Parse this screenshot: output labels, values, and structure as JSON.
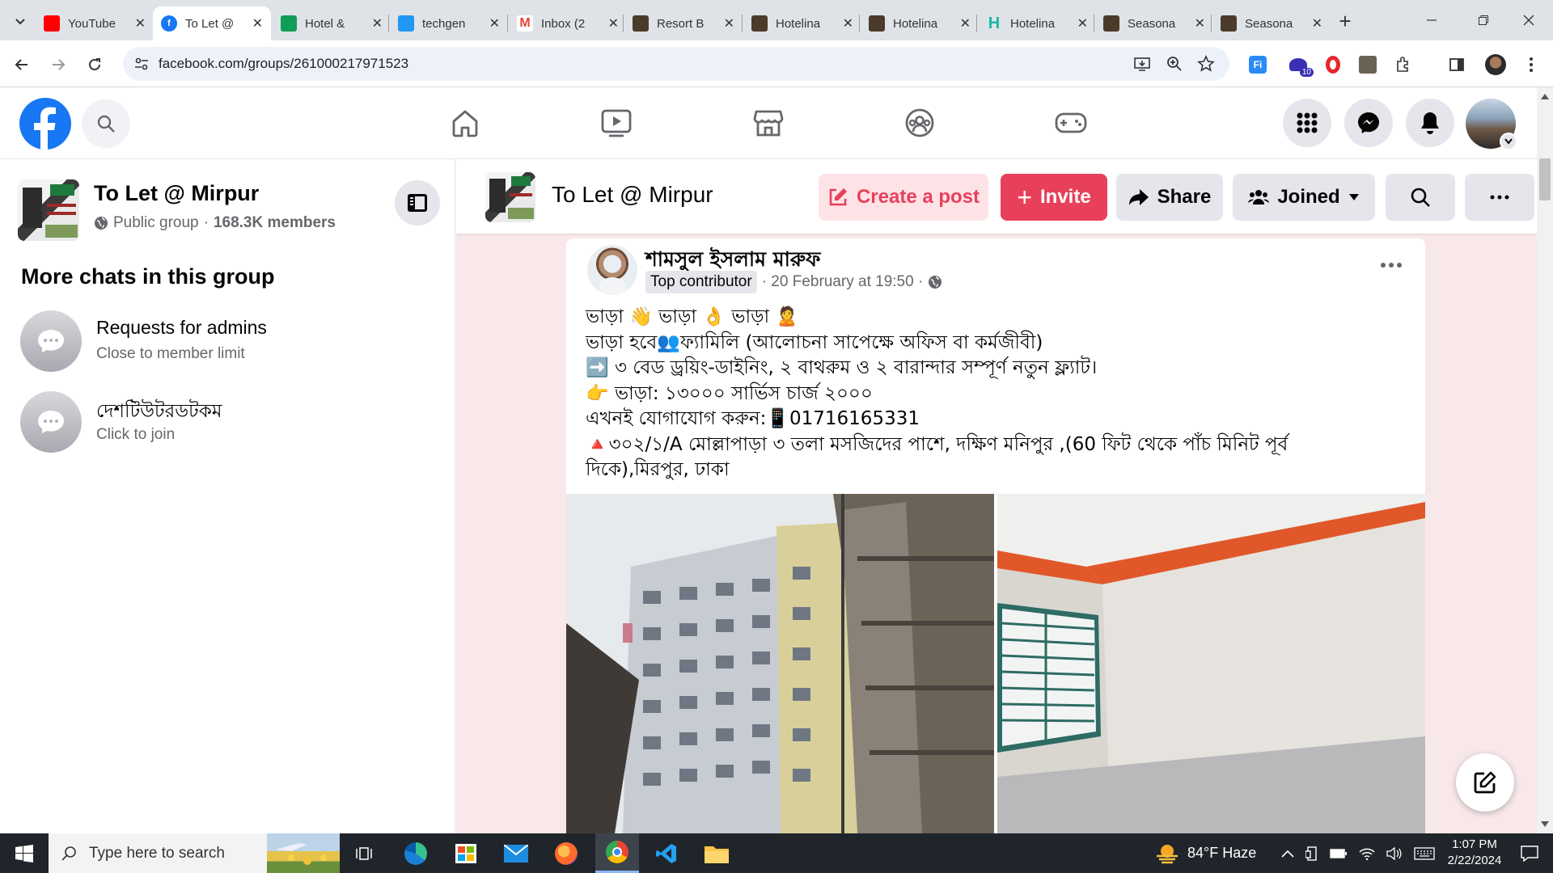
{
  "browser": {
    "tabs": [
      {
        "title": "YouTube",
        "icon": "youtube-icon",
        "color": "#ff0000"
      },
      {
        "title": "To Let @",
        "icon": "facebook-icon",
        "color": "#1877f2",
        "active": true
      },
      {
        "title": "Hotel &",
        "icon": "sheets-icon",
        "color": "#0f9d58"
      },
      {
        "title": "techgen",
        "icon": "techgen-icon",
        "color": "#2196f3"
      },
      {
        "title": "Inbox (2",
        "icon": "gmail-icon",
        "color": "#ea4335"
      },
      {
        "title": "Resort B",
        "icon": "site-icon",
        "color": "#4a3b2a"
      },
      {
        "title": "Hotelina",
        "icon": "site-icon",
        "color": "#4a3b2a"
      },
      {
        "title": "Hotelina",
        "icon": "site-icon",
        "color": "#4a3b2a"
      },
      {
        "title": "Hotelina",
        "icon": "hotelina-h-icon",
        "color": "#14b8a6"
      },
      {
        "title": "Seasona",
        "icon": "site-icon",
        "color": "#4a3b2a"
      },
      {
        "title": "Seasona",
        "icon": "site-icon",
        "color": "#4a3b2a"
      }
    ],
    "url": "facebook.com/groups/261000217971523",
    "extension_badge": "10"
  },
  "group": {
    "name": "To Let @ Mirpur",
    "privacy": "Public group",
    "separator": "·",
    "members": "168.3K members"
  },
  "sidebar": {
    "section_title": "More chats in this group",
    "chats": [
      {
        "title": "Requests for admins",
        "subtitle": "Close to member limit"
      },
      {
        "title": "দেশটিউটরডটকম",
        "subtitle": "Click to join"
      }
    ]
  },
  "group_header": {
    "title": "To Let @ Mirpur",
    "create_post": "Create a post",
    "invite": "Invite",
    "share": "Share",
    "joined": "Joined"
  },
  "post": {
    "author": "শামসুল ইসলাম মারুফ",
    "badge": "Top contributor",
    "timestamp": "· 20 February at 19:50 ·",
    "lines": [
      "ভাড়া 👋 ভাড়া 👌 ভাড়া 🙎",
      "ভাড়া হবে👥ফ্যামিলি (আলোচনা সাপেক্ষে অফিস বা কর্মজীবী)",
      "➡️ ৩ বেড ড্রয়িং-ডাইনিং, ২ বাথরুম ও ২ বারান্দার সম্পূর্ণ নতুন ফ্ল্যাট।",
      "👉 ভাড়া: ১৩০০০ সার্ভিস চার্জ ২০০০",
      "এখনই যোগাযোগ করুন:📱01716165331",
      "🔺৩০২/১/A মোল্লাপাড়া ৩ তলা মসজিদের পাশে, দক্ষিণ মনিপুর ,(60 ফিট থেকে পাঁচ মিনিট পূর্ব",
      "দিকে),মিরপুর, ঢাকা"
    ]
  },
  "taskbar": {
    "search_placeholder": "Type here to search",
    "weather": "84°F  Haze",
    "time": "1:07 PM",
    "date": "2/22/2024"
  },
  "colors": {
    "facebook_blue": "#1877f2",
    "invite_red": "#e8405a",
    "create_post_bg": "#fde3e6",
    "group_bg": "#f8e8ea"
  }
}
